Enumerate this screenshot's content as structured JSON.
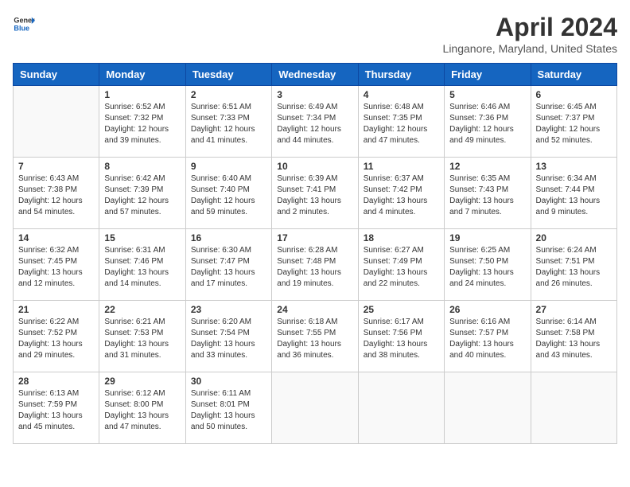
{
  "header": {
    "logo_general": "General",
    "logo_blue": "Blue",
    "main_title": "April 2024",
    "subtitle": "Linganore, Maryland, United States"
  },
  "calendar": {
    "weekdays": [
      "Sunday",
      "Monday",
      "Tuesday",
      "Wednesday",
      "Thursday",
      "Friday",
      "Saturday"
    ],
    "weeks": [
      [
        {
          "day": "",
          "info": ""
        },
        {
          "day": "1",
          "info": "Sunrise: 6:52 AM\nSunset: 7:32 PM\nDaylight: 12 hours\nand 39 minutes."
        },
        {
          "day": "2",
          "info": "Sunrise: 6:51 AM\nSunset: 7:33 PM\nDaylight: 12 hours\nand 41 minutes."
        },
        {
          "day": "3",
          "info": "Sunrise: 6:49 AM\nSunset: 7:34 PM\nDaylight: 12 hours\nand 44 minutes."
        },
        {
          "day": "4",
          "info": "Sunrise: 6:48 AM\nSunset: 7:35 PM\nDaylight: 12 hours\nand 47 minutes."
        },
        {
          "day": "5",
          "info": "Sunrise: 6:46 AM\nSunset: 7:36 PM\nDaylight: 12 hours\nand 49 minutes."
        },
        {
          "day": "6",
          "info": "Sunrise: 6:45 AM\nSunset: 7:37 PM\nDaylight: 12 hours\nand 52 minutes."
        }
      ],
      [
        {
          "day": "7",
          "info": "Sunrise: 6:43 AM\nSunset: 7:38 PM\nDaylight: 12 hours\nand 54 minutes."
        },
        {
          "day": "8",
          "info": "Sunrise: 6:42 AM\nSunset: 7:39 PM\nDaylight: 12 hours\nand 57 minutes."
        },
        {
          "day": "9",
          "info": "Sunrise: 6:40 AM\nSunset: 7:40 PM\nDaylight: 12 hours\nand 59 minutes."
        },
        {
          "day": "10",
          "info": "Sunrise: 6:39 AM\nSunset: 7:41 PM\nDaylight: 13 hours\nand 2 minutes."
        },
        {
          "day": "11",
          "info": "Sunrise: 6:37 AM\nSunset: 7:42 PM\nDaylight: 13 hours\nand 4 minutes."
        },
        {
          "day": "12",
          "info": "Sunrise: 6:35 AM\nSunset: 7:43 PM\nDaylight: 13 hours\nand 7 minutes."
        },
        {
          "day": "13",
          "info": "Sunrise: 6:34 AM\nSunset: 7:44 PM\nDaylight: 13 hours\nand 9 minutes."
        }
      ],
      [
        {
          "day": "14",
          "info": "Sunrise: 6:32 AM\nSunset: 7:45 PM\nDaylight: 13 hours\nand 12 minutes."
        },
        {
          "day": "15",
          "info": "Sunrise: 6:31 AM\nSunset: 7:46 PM\nDaylight: 13 hours\nand 14 minutes."
        },
        {
          "day": "16",
          "info": "Sunrise: 6:30 AM\nSunset: 7:47 PM\nDaylight: 13 hours\nand 17 minutes."
        },
        {
          "day": "17",
          "info": "Sunrise: 6:28 AM\nSunset: 7:48 PM\nDaylight: 13 hours\nand 19 minutes."
        },
        {
          "day": "18",
          "info": "Sunrise: 6:27 AM\nSunset: 7:49 PM\nDaylight: 13 hours\nand 22 minutes."
        },
        {
          "day": "19",
          "info": "Sunrise: 6:25 AM\nSunset: 7:50 PM\nDaylight: 13 hours\nand 24 minutes."
        },
        {
          "day": "20",
          "info": "Sunrise: 6:24 AM\nSunset: 7:51 PM\nDaylight: 13 hours\nand 26 minutes."
        }
      ],
      [
        {
          "day": "21",
          "info": "Sunrise: 6:22 AM\nSunset: 7:52 PM\nDaylight: 13 hours\nand 29 minutes."
        },
        {
          "day": "22",
          "info": "Sunrise: 6:21 AM\nSunset: 7:53 PM\nDaylight: 13 hours\nand 31 minutes."
        },
        {
          "day": "23",
          "info": "Sunrise: 6:20 AM\nSunset: 7:54 PM\nDaylight: 13 hours\nand 33 minutes."
        },
        {
          "day": "24",
          "info": "Sunrise: 6:18 AM\nSunset: 7:55 PM\nDaylight: 13 hours\nand 36 minutes."
        },
        {
          "day": "25",
          "info": "Sunrise: 6:17 AM\nSunset: 7:56 PM\nDaylight: 13 hours\nand 38 minutes."
        },
        {
          "day": "26",
          "info": "Sunrise: 6:16 AM\nSunset: 7:57 PM\nDaylight: 13 hours\nand 40 minutes."
        },
        {
          "day": "27",
          "info": "Sunrise: 6:14 AM\nSunset: 7:58 PM\nDaylight: 13 hours\nand 43 minutes."
        }
      ],
      [
        {
          "day": "28",
          "info": "Sunrise: 6:13 AM\nSunset: 7:59 PM\nDaylight: 13 hours\nand 45 minutes."
        },
        {
          "day": "29",
          "info": "Sunrise: 6:12 AM\nSunset: 8:00 PM\nDaylight: 13 hours\nand 47 minutes."
        },
        {
          "day": "30",
          "info": "Sunrise: 6:11 AM\nSunset: 8:01 PM\nDaylight: 13 hours\nand 50 minutes."
        },
        {
          "day": "",
          "info": ""
        },
        {
          "day": "",
          "info": ""
        },
        {
          "day": "",
          "info": ""
        },
        {
          "day": "",
          "info": ""
        }
      ]
    ]
  }
}
